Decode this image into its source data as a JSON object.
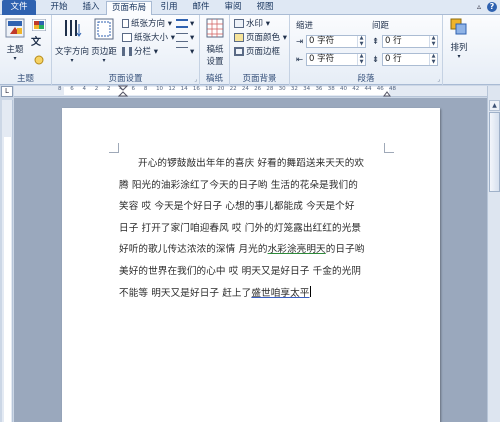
{
  "tabs": [
    "文件",
    "开始",
    "插入",
    "页面布局",
    "引用",
    "邮件",
    "审阅",
    "视图"
  ],
  "ribbon": {
    "theme": {
      "theme_btn": "主题",
      "group": "主题"
    },
    "page_setup": {
      "text_direction": "文字方向",
      "margins": "页边距",
      "orientation": "纸张方向",
      "size": "纸张大小",
      "columns": "分栏",
      "group": "页面设置"
    },
    "draft": {
      "btn_line1": "稿纸",
      "btn_line2": "设置",
      "group": "稿纸"
    },
    "page_background": {
      "watermark": "水印",
      "page_color": "页面颜色",
      "page_border": "页面边框",
      "group": "页面背景"
    },
    "paragraph": {
      "indent_label": "缩进",
      "spacing_label": "间距",
      "indent_left": "0 字符",
      "indent_right": "0 字符",
      "spacing_before": "0 行",
      "spacing_after": "0 行",
      "group": "段落"
    },
    "arrange": {
      "btn": "排列"
    }
  },
  "ruler": {
    "numbers": [
      "8",
      "6",
      "4",
      "2",
      "2",
      "4",
      "6",
      "8",
      "10",
      "12",
      "14",
      "16",
      "18",
      "20",
      "22",
      "24",
      "26",
      "28",
      "30",
      "32",
      "34",
      "36",
      "38",
      "40",
      "42",
      "44",
      "46",
      "48"
    ]
  },
  "document": {
    "line1": "开心的锣鼓敲出年年的喜庆  好看的舞蹈送来天天的欢",
    "line2": "腾  阳光的油彩涂红了今天的日子哟  生活的花朵是我们的",
    "line3": "笑容  哎  今天是个好日子  心想的事儿都能成  今天是个好",
    "line4": "日子  打开了家门咱迎春风  哎  门外的灯笼露出红红的光景",
    "line5_a": "好听的歌儿传达浓浓的深情  月光的",
    "line5_b": "水彩涂亮明天",
    "line5_c": "的日子哟",
    "line6": "美好的世界在我们的心中  哎  明天又是好日子  千金的光阴",
    "line7_a": "不能等  明天又是好日子  赶上了",
    "line7_b": "盛世咱享太平"
  },
  "colors": {
    "file_tab": "#2f62b0",
    "grammar_underline": "#2e8b3a",
    "spell_underline": "#3a5fc0"
  }
}
